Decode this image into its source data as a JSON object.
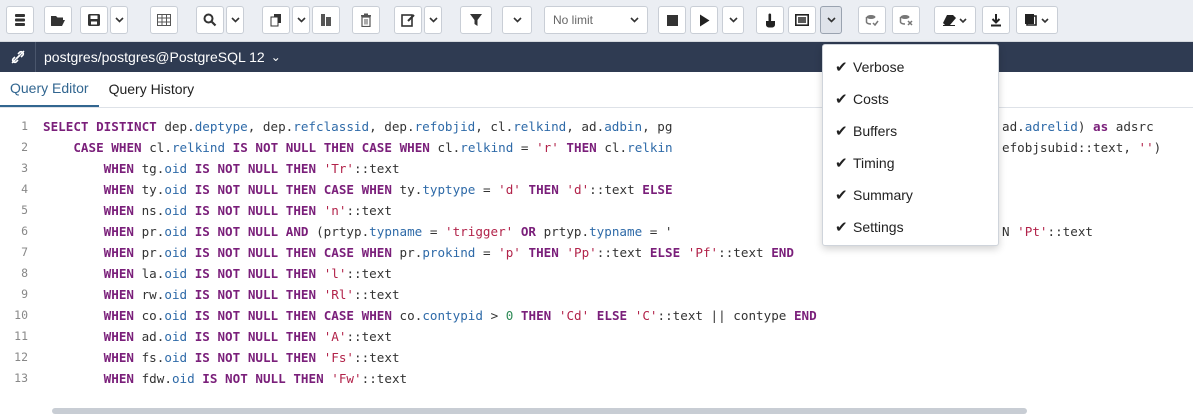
{
  "toolbar": {
    "row_limit": {
      "selected": "No limit"
    }
  },
  "connection": {
    "label": "postgres/postgres@PostgreSQL 12",
    "caret": "⌄"
  },
  "tabs": [
    {
      "label": "Query Editor",
      "active": true
    },
    {
      "label": "Query History",
      "active": false
    }
  ],
  "explain_menu": {
    "items": [
      {
        "label": "Verbose",
        "checked": true
      },
      {
        "label": "Costs",
        "checked": true
      },
      {
        "label": "Buffers",
        "checked": true
      },
      {
        "label": "Timing",
        "checked": true
      },
      {
        "label": "Summary",
        "checked": true
      },
      {
        "label": "Settings",
        "checked": true
      }
    ]
  },
  "editor": {
    "lines": [
      {
        "n": "1",
        "t": "SELECT DISTINCT dep.deptype, dep.refclassid, dep.refobjid, cl.relkind, ad.adbin, pg"
      },
      {
        "n": "2",
        "t": "    CASE WHEN cl.relkind IS NOT NULL THEN CASE WHEN cl.relkind = 'r' THEN cl.relkin"
      },
      {
        "n": "3",
        "t": "        WHEN tg.oid IS NOT NULL THEN 'Tr'::text"
      },
      {
        "n": "4",
        "t": "        WHEN ty.oid IS NOT NULL THEN CASE WHEN ty.typtype = 'd' THEN 'd'::text ELSE"
      },
      {
        "n": "5",
        "t": "        WHEN ns.oid IS NOT NULL THEN 'n'::text"
      },
      {
        "n": "6",
        "t": "        WHEN pr.oid IS NOT NULL AND (prtyp.typname = 'trigger' OR prtyp.typname = '"
      },
      {
        "n": "7",
        "t": "        WHEN pr.oid IS NOT NULL THEN CASE WHEN pr.prokind = 'p' THEN 'Pp'::text ELSE 'Pf'::text END"
      },
      {
        "n": "8",
        "t": "        WHEN la.oid IS NOT NULL THEN 'l'::text"
      },
      {
        "n": "9",
        "t": "        WHEN rw.oid IS NOT NULL THEN 'Rl'::text"
      },
      {
        "n": "10",
        "t": "        WHEN co.oid IS NOT NULL THEN CASE WHEN co.contypid > 0 THEN 'Cd' ELSE 'C'::text || contype END"
      },
      {
        "n": "11",
        "t": "        WHEN ad.oid IS NOT NULL THEN 'A'::text"
      },
      {
        "n": "12",
        "t": "        WHEN fs.oid IS NOT NULL THEN 'Fs'::text"
      },
      {
        "n": "13",
        "t": "        WHEN fdw.oid IS NOT NULL THEN 'Fw'::text"
      }
    ],
    "overflow_fragments": [
      {
        "line": "1",
        "t": "ad.adrelid) as adsrc"
      },
      {
        "line": "2",
        "t": "efobjsubid::text, '')"
      },
      {
        "line": "6",
        "t": "N 'Pt'::text"
      }
    ]
  }
}
